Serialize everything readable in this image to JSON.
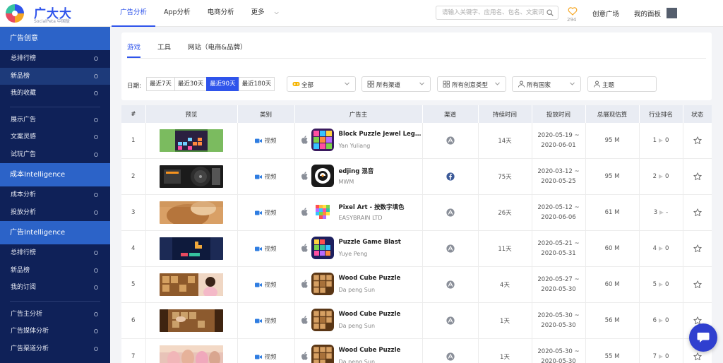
{
  "brand": {
    "name": "广大大",
    "sub": "SocialPeta 中国版",
    "accent": "#2f54eb"
  },
  "topnav": {
    "items": [
      {
        "label": "广告分析",
        "active": true
      },
      {
        "label": "App分析",
        "active": false
      },
      {
        "label": "电商分析",
        "active": false
      },
      {
        "label": "更多",
        "active": false
      }
    ],
    "search_placeholder": "请输入关键字、应用名、包名、文案词",
    "heart_count": "294",
    "links": [
      "创意广场",
      "我的面板"
    ]
  },
  "sidebar": {
    "sections": [
      {
        "title": "广告创意",
        "groups": [
          [
            "总排行榜",
            "新品榜",
            "我的收藏"
          ],
          [
            "展示广告",
            "文案灵感",
            "试玩广告"
          ]
        ]
      },
      {
        "title": "成本Intelligence",
        "groups": [
          [
            "成本分析",
            "投放分析"
          ]
        ]
      },
      {
        "title": "广告Intelligence",
        "groups": [
          [
            "总排行榜",
            "新品榜",
            "我的订阅"
          ],
          [
            "广告主分析",
            "广告媒体分析",
            "广告渠道分析"
          ]
        ]
      }
    ],
    "active_item": "新品榜"
  },
  "filters": {
    "tabs": [
      {
        "label": "游戏",
        "active": true
      },
      {
        "label": "工具",
        "active": false
      },
      {
        "label": "网站（电商&品牌）",
        "active": false
      }
    ],
    "date_label": "日期:",
    "date_options": [
      {
        "label": "最近7天",
        "active": false
      },
      {
        "label": "最近30天",
        "active": false
      },
      {
        "label": "最近90天",
        "active": true
      },
      {
        "label": "最近180天",
        "active": false
      }
    ],
    "selects": [
      {
        "icon": "gamepad-icon",
        "label": "全部"
      },
      {
        "icon": "grid-icon",
        "label": "所有渠道"
      },
      {
        "icon": "grid-icon",
        "label": "所有创意类型"
      },
      {
        "icon": "user-icon",
        "label": "所有国家"
      },
      {
        "icon": "user-icon",
        "label": "主题"
      }
    ]
  },
  "table": {
    "headers": [
      "#",
      "预览",
      "类别",
      "广告主",
      "渠道",
      "持续时间",
      "投放时间",
      "总展现估算",
      "行业排名",
      "状态"
    ],
    "type_label": "视频",
    "rows": [
      {
        "rank": "1",
        "preview": "puzzle-grid",
        "name": "Block Puzzle Jewel Legend",
        "dev": "Yan Yuliang",
        "icon": "jewel-blocks",
        "channel": "admob",
        "duration": "14天",
        "start": "2020-05-19 ~",
        "end": "2020-06-01",
        "impressions": "95 M",
        "ind_rank_a": "1",
        "ind_rank_b": "0"
      },
      {
        "rank": "2",
        "preview": "dj-deck",
        "name": "edjing 混音",
        "dev": "MWM",
        "icon": "edjing",
        "channel": "facebook",
        "duration": "75天",
        "start": "2020-03-12 ~",
        "end": "2020-05-25",
        "impressions": "95 M",
        "ind_rank_a": "2",
        "ind_rank_b": "0"
      },
      {
        "rank": "3",
        "preview": "pixel-pet",
        "name": "Pixel Art - 按数字填色",
        "dev": "EASYBRAIN LTD",
        "icon": "pixel-art",
        "channel": "admob",
        "duration": "26天",
        "start": "2020-05-12 ~",
        "end": "2020-06-06",
        "impressions": "61 M",
        "ind_rank_a": "3",
        "ind_rank_b": "-"
      },
      {
        "rank": "4",
        "preview": "dark-blocks",
        "name": "Puzzle Game Blast",
        "dev": "Yuye Peng",
        "icon": "blast-blocks",
        "channel": "admob",
        "duration": "11天",
        "start": "2020-05-21 ~",
        "end": "2020-05-31",
        "impressions": "60 M",
        "ind_rank_a": "4",
        "ind_rank_b": "0"
      },
      {
        "rank": "5",
        "preview": "wood-woman",
        "name": "Wood Cube Puzzle",
        "dev": "Da peng Sun",
        "icon": "wood-cubes",
        "channel": "admob",
        "duration": "4天",
        "start": "2020-05-27 ~",
        "end": "2020-05-30",
        "impressions": "60 M",
        "ind_rank_a": "5",
        "ind_rank_b": "0"
      },
      {
        "rank": "6",
        "preview": "wood-hand",
        "name": "Wood Cube Puzzle",
        "dev": "Da peng Sun",
        "icon": "wood-cubes",
        "channel": "admob",
        "duration": "1天",
        "start": "2020-05-30 ~",
        "end": "2020-05-30",
        "impressions": "56 M",
        "ind_rank_a": "6",
        "ind_rank_b": "0"
      },
      {
        "rank": "7",
        "preview": "blurred-crowd",
        "name": "Wood Cube Puzzle",
        "dev": "Da peng Sun",
        "icon": "wood-cubes",
        "channel": "admob",
        "duration": "1天",
        "start": "2020-05-30 ~",
        "end": "2020-05-30",
        "impressions": "55 M",
        "ind_rank_a": "7",
        "ind_rank_b": "0"
      }
    ]
  }
}
